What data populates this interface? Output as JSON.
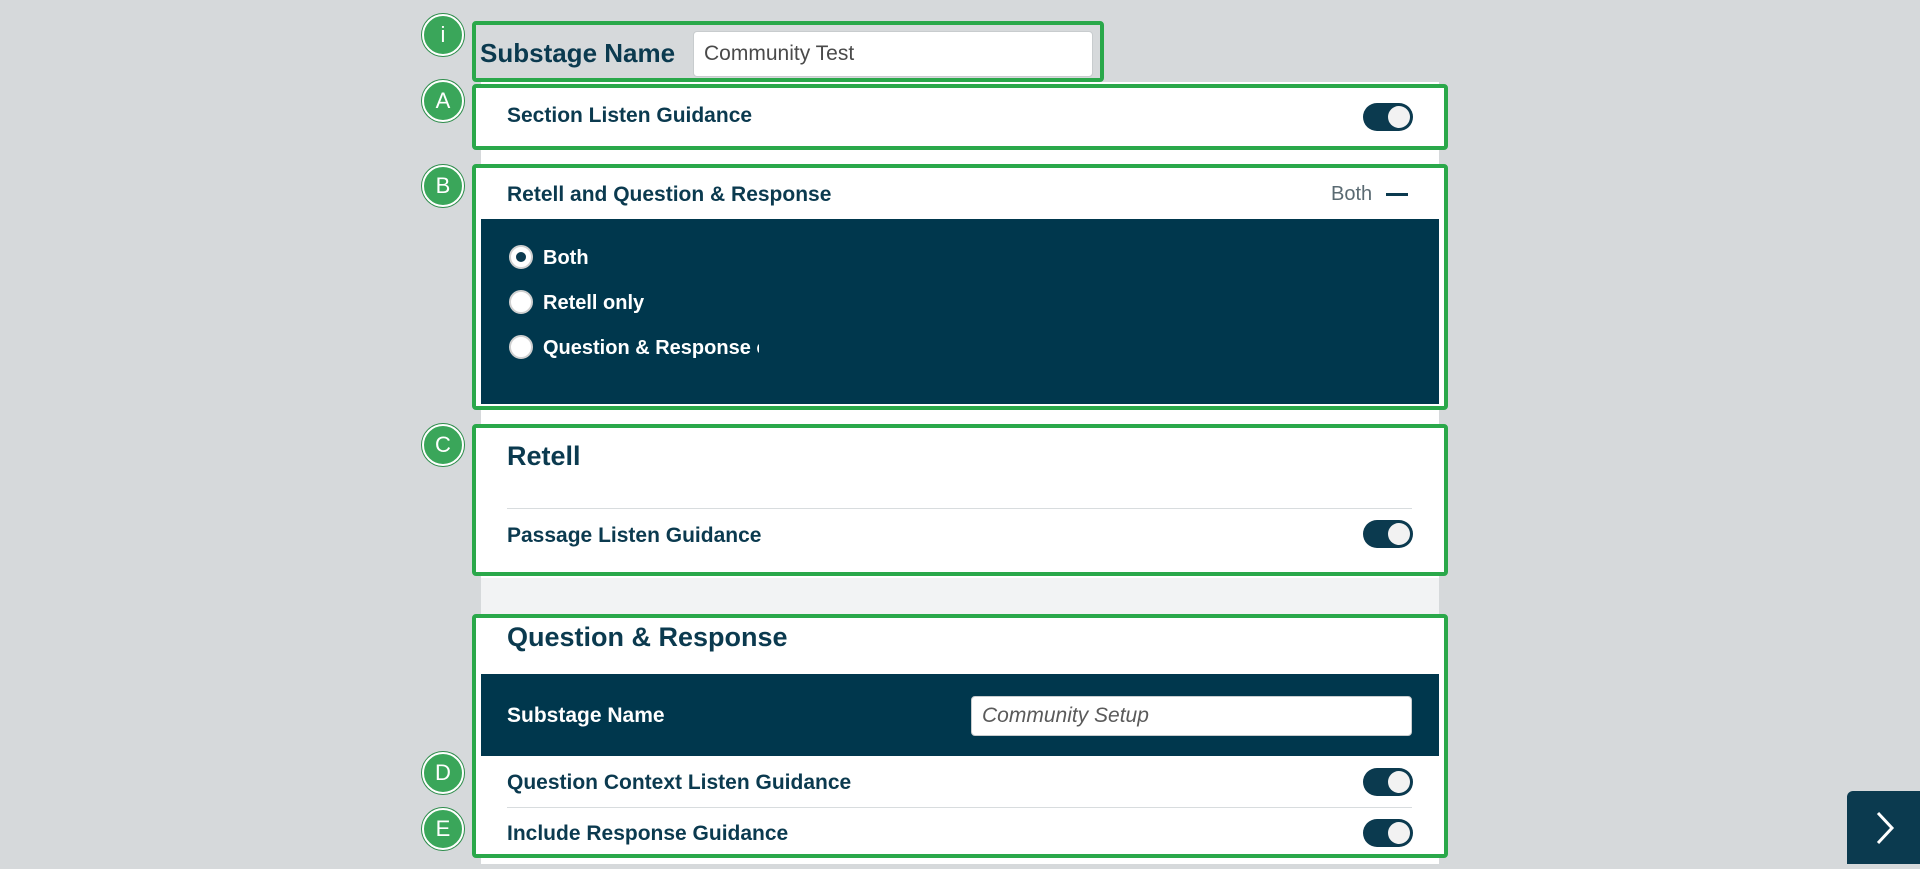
{
  "markers": [
    "i",
    "A",
    "B",
    "C",
    "D",
    "E"
  ],
  "substage": {
    "label": "Substage Name",
    "value": "Community Test"
  },
  "section_listen": {
    "label": "Section Listen Guidance",
    "toggle_on": true
  },
  "retell_qr": {
    "label": "Retell and Question & Response",
    "selected_value": "Both",
    "options": [
      "Both",
      "Retell only",
      "Question & Response only"
    ],
    "selected_index": 0
  },
  "retell": {
    "heading": "Retell",
    "passage_listen": {
      "label": "Passage Listen Guidance",
      "toggle_on": true
    }
  },
  "qr": {
    "heading": "Question & Response",
    "substage_label": "Substage Name",
    "substage_value": "Community Setup",
    "context_listen": {
      "label": "Question Context Listen Guidance",
      "toggle_on": true
    },
    "response_guidance": {
      "label": "Include Response Guidance",
      "toggle_on": true
    }
  },
  "colors": {
    "highlight": "#2aa84a",
    "navy": "#00374d",
    "marker": "#3aa65a",
    "background": "#d6d9db"
  },
  "icons": {
    "collapse": "minus-icon",
    "next": "chevron-right-icon"
  }
}
